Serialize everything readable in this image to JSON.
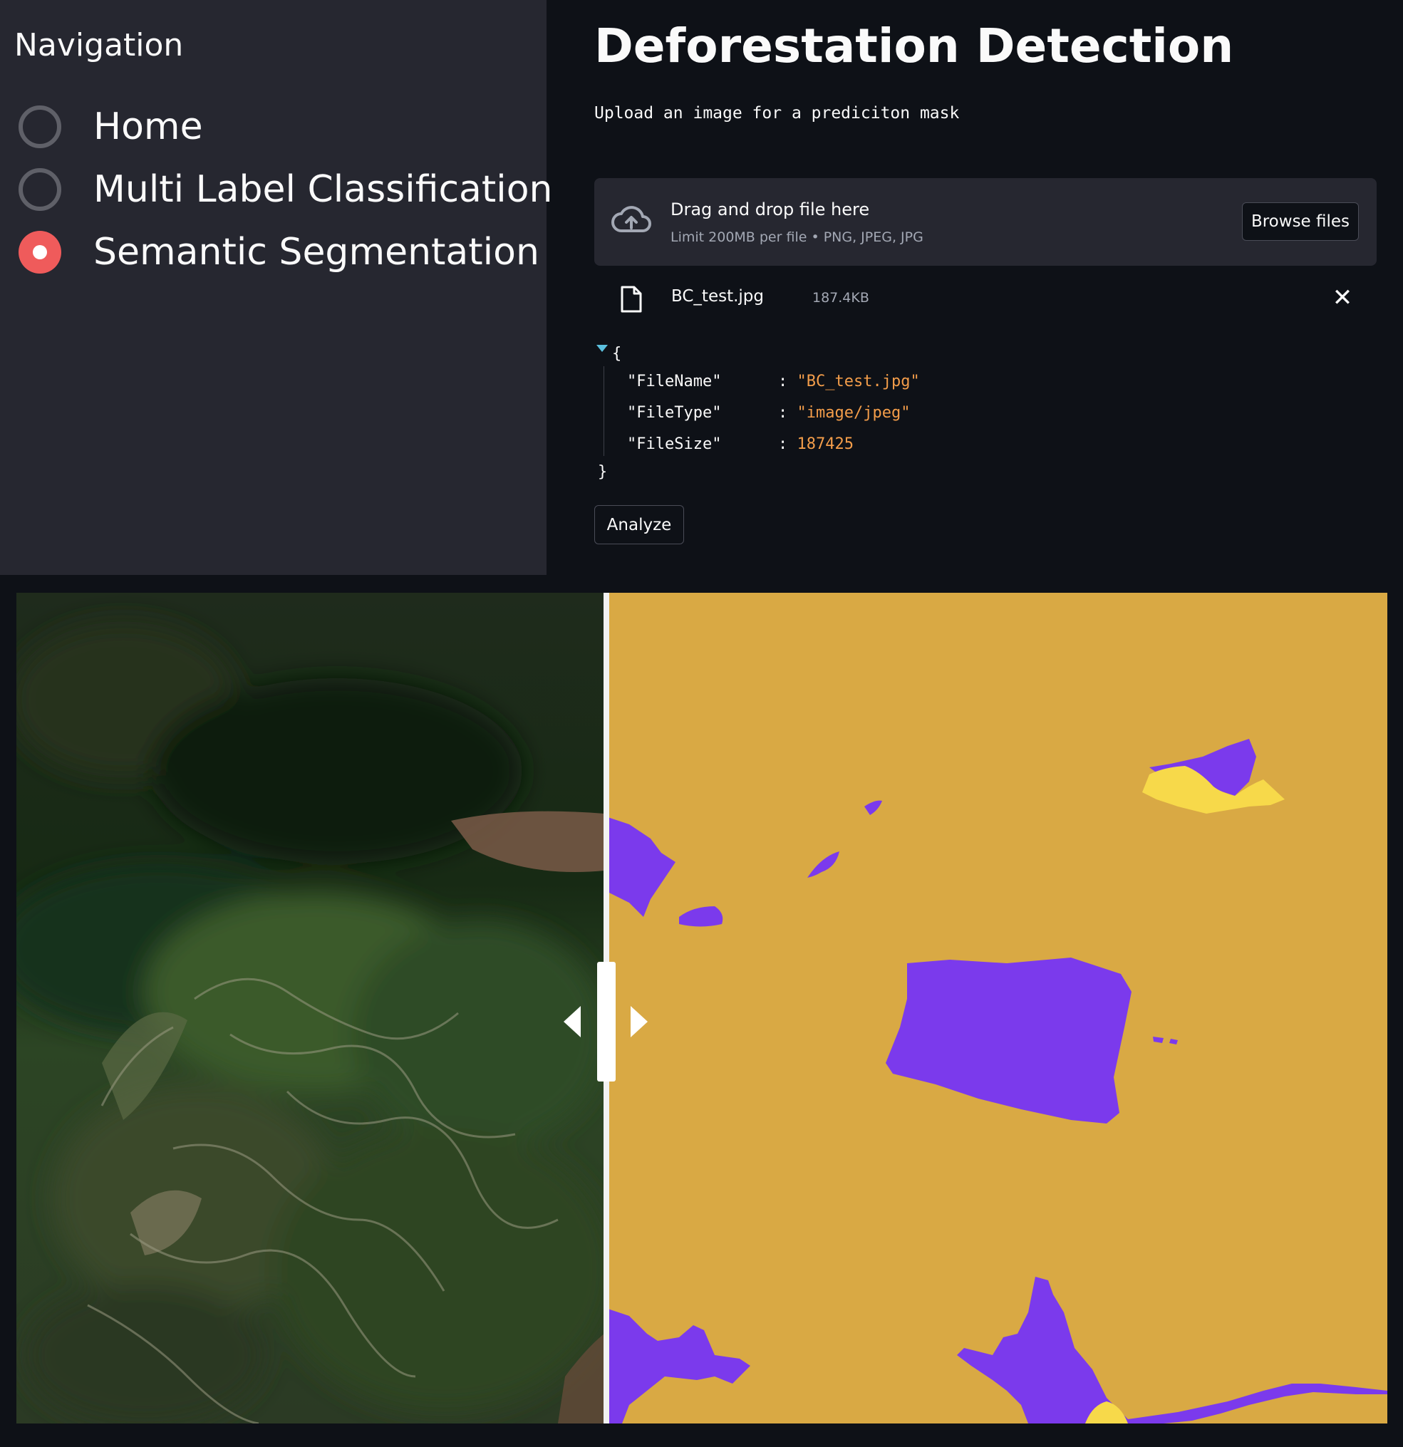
{
  "sidebar": {
    "title": "Navigation",
    "options": [
      {
        "label": "Home",
        "selected": false
      },
      {
        "label": "Multi Label Classification",
        "selected": false
      },
      {
        "label": "Semantic Segmentation",
        "selected": true
      }
    ]
  },
  "main": {
    "title": "Deforestation Detection",
    "subtitle": "Upload an image for a prediciton mask",
    "uploader": {
      "drag_text": "Drag and drop file here",
      "limit_text": "Limit 200MB per file • PNG, JPEG, JPG",
      "browse_label": "Browse files"
    },
    "uploaded_file": {
      "name": "BC_test.jpg",
      "size": "187.4KB"
    },
    "json": {
      "open": "{",
      "close": "}",
      "entries": [
        {
          "key": "\"FileName\"",
          "value": "\"BC_test.jpg\""
        },
        {
          "key": "\"FileType\"",
          "value": "\"image/jpeg\""
        },
        {
          "key": "\"FileSize\"",
          "value": "187425"
        }
      ]
    },
    "analyze_label": "Analyze"
  },
  "colors": {
    "sidebar_bg": "#262730",
    "app_bg": "#0e1117",
    "accent_radio": "#ef5b5b",
    "json_value": "#f39d4a",
    "mask_background": "#d9a944",
    "mask_class_purple": "#7b3aec",
    "mask_class_yellow": "#f7d94a"
  },
  "icons": {
    "upload": "cloud-upload-icon",
    "file": "file-icon",
    "close": "close-icon"
  }
}
